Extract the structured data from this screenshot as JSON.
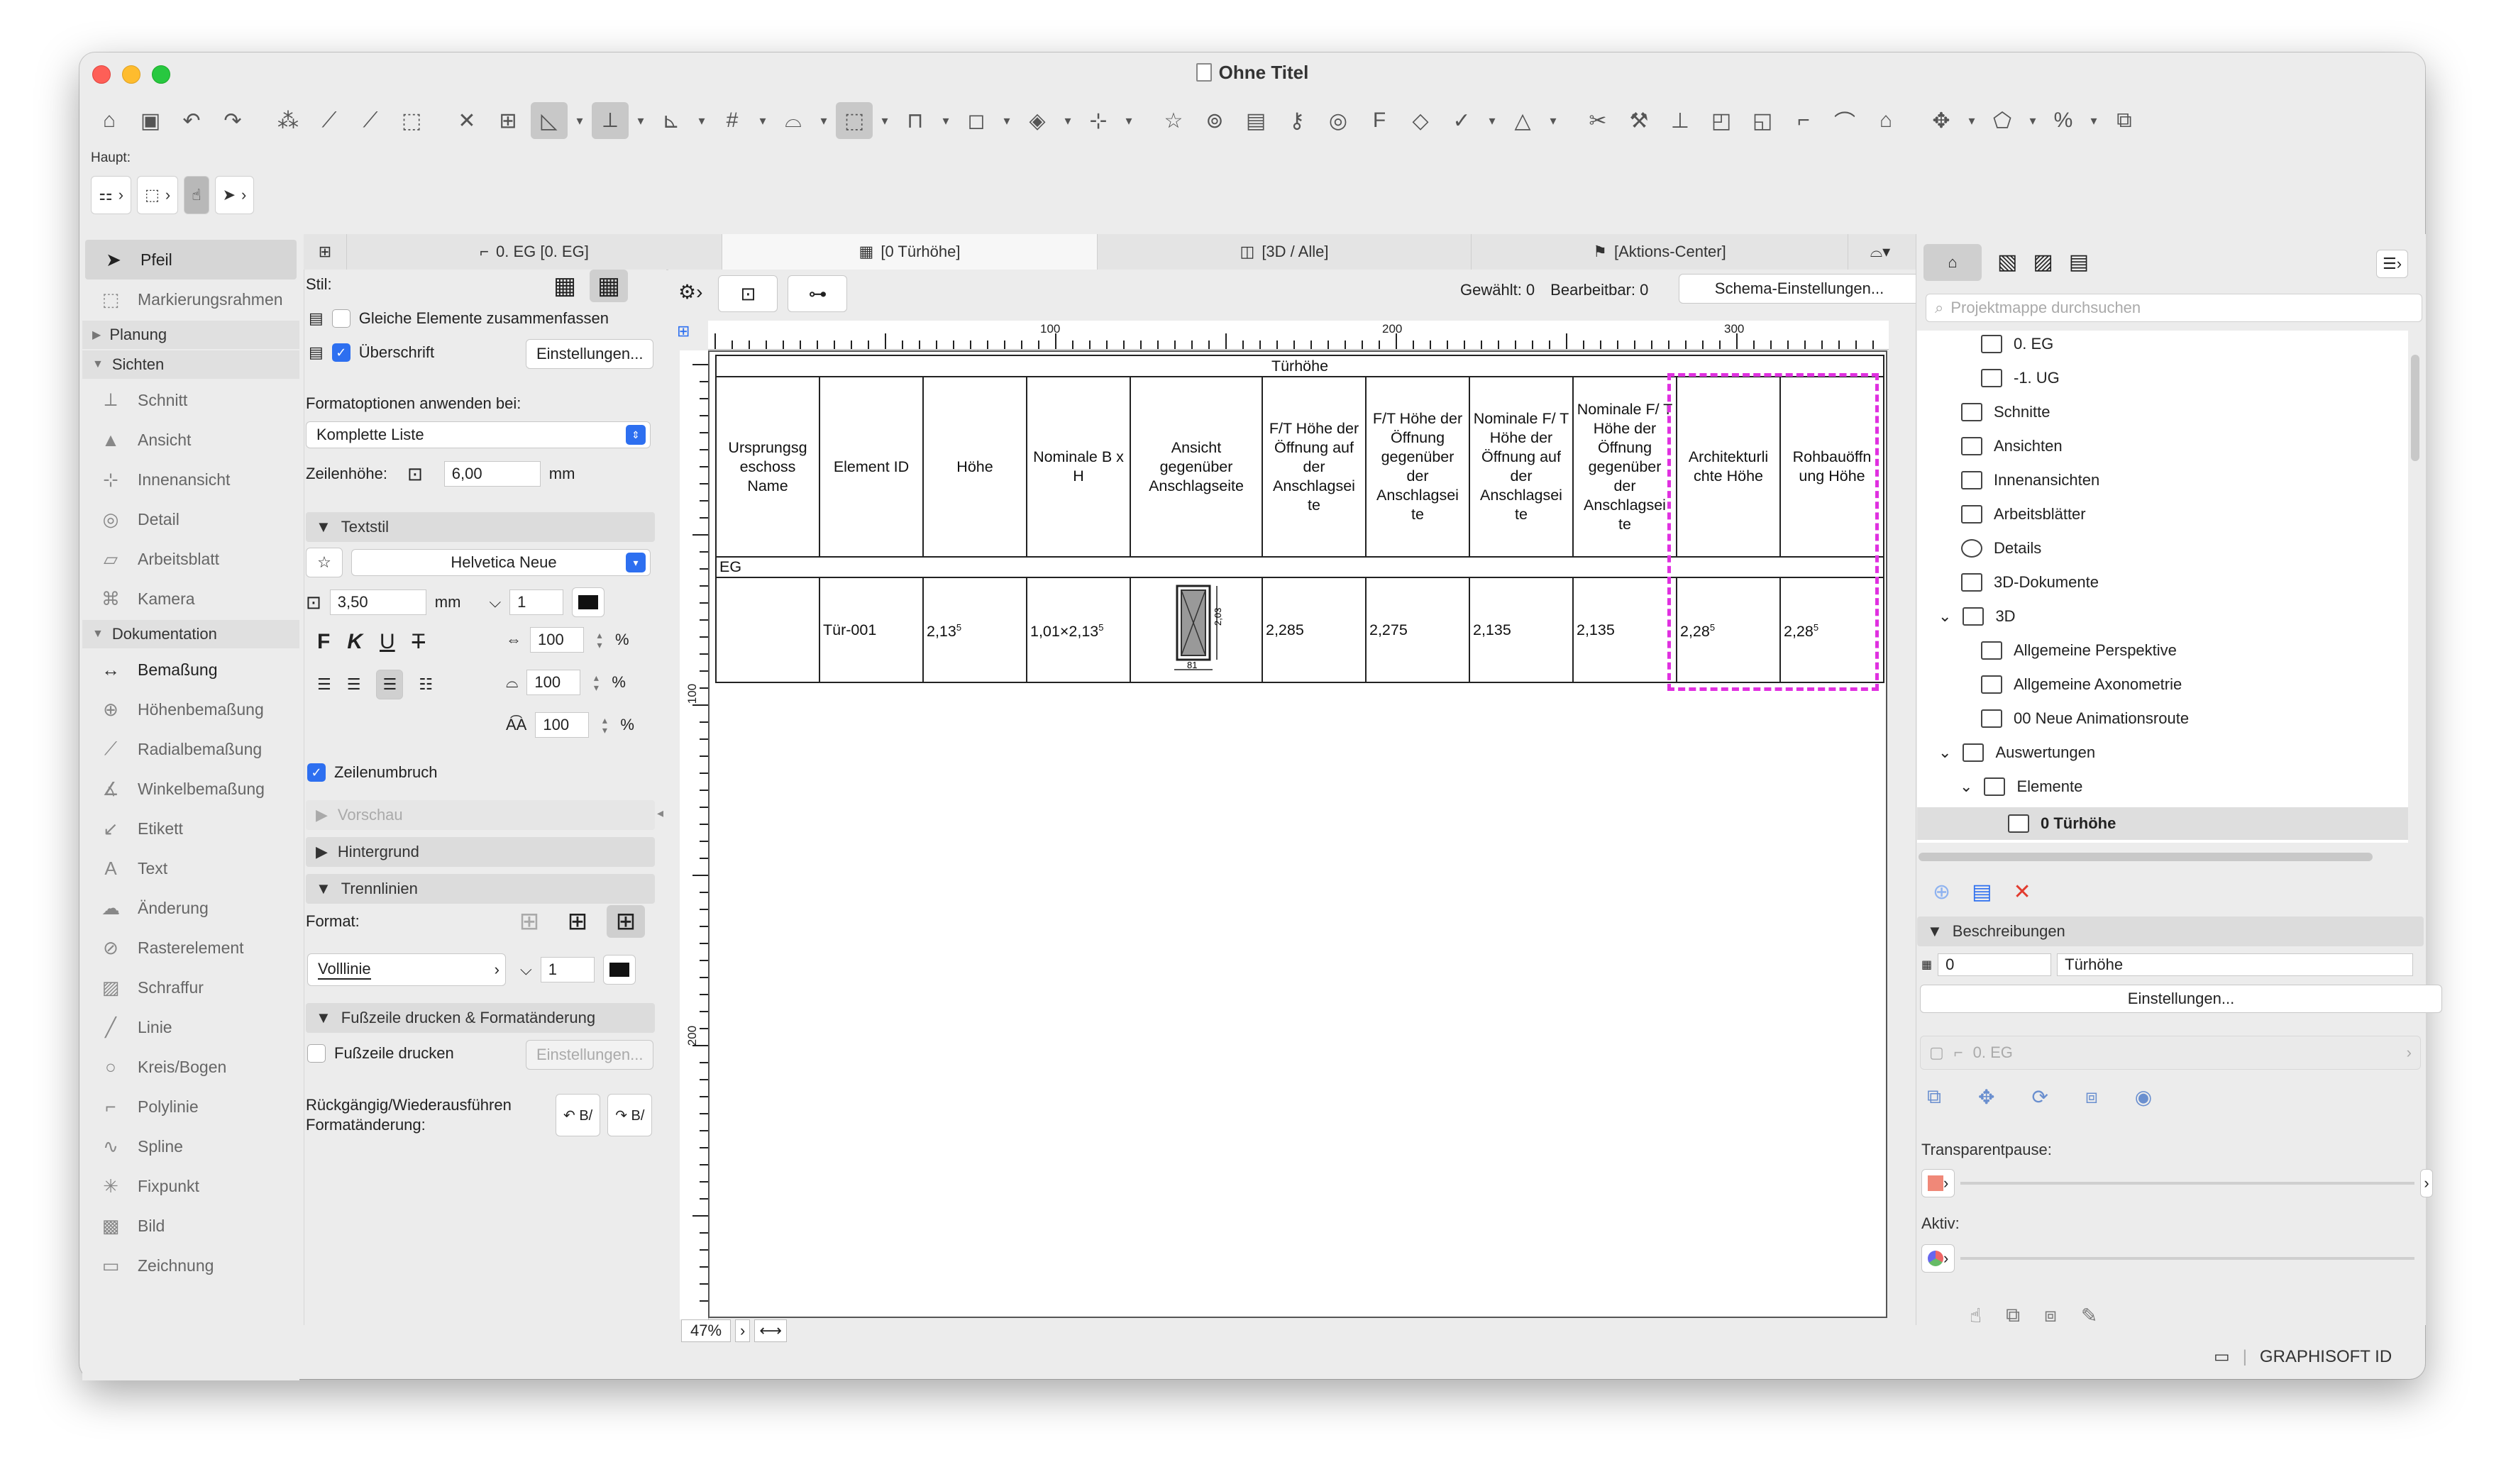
{
  "window": {
    "title": "Ohne Titel"
  },
  "toolbar": {
    "haupt_label": "Haupt:"
  },
  "toolbox": {
    "items": [
      {
        "label": "Pfeil"
      },
      {
        "label": "Markierungsrahmen"
      },
      {
        "label": "Planung"
      },
      {
        "label": "Sichten"
      },
      {
        "label": "Schnitt"
      },
      {
        "label": "Ansicht"
      },
      {
        "label": "Innenansicht"
      },
      {
        "label": "Detail"
      },
      {
        "label": "Arbeitsblatt"
      },
      {
        "label": "Kamera"
      },
      {
        "label": "Dokumentation"
      },
      {
        "label": "Bemaßung"
      },
      {
        "label": "Höhenbemaßung"
      },
      {
        "label": "Radialbemaßung"
      },
      {
        "label": "Winkelbemaßung"
      },
      {
        "label": "Etikett"
      },
      {
        "label": "Text"
      },
      {
        "label": "Änderung"
      },
      {
        "label": "Rasterelement"
      },
      {
        "label": "Schraffur"
      },
      {
        "label": "Linie"
      },
      {
        "label": "Kreis/Bogen"
      },
      {
        "label": "Polylinie"
      },
      {
        "label": "Spline"
      },
      {
        "label": "Fixpunkt"
      },
      {
        "label": "Bild"
      },
      {
        "label": "Zeichnung"
      }
    ]
  },
  "tabs": [
    {
      "label": "0. EG [0. EG]"
    },
    {
      "label": "[0 Türhöhe]"
    },
    {
      "label": "[3D / Alle]"
    },
    {
      "label": "[Aktions-Center]"
    }
  ],
  "panel": {
    "stil_label": "Stil:",
    "gleiche_label": "Gleiche Elemente zusammenfassen",
    "ueberschrift_label": "Überschrift",
    "einstellungen": "Einstellungen...",
    "formatoptionen_label": "Formatoptionen anwenden bei:",
    "formatoptionen_value": "Komplette Liste",
    "zeilenhoehe_label": "Zeilenhöhe:",
    "zeilenhoehe_value": "6,00",
    "unit_mm": "mm",
    "textstil": "Textstil",
    "font": "Helvetica Neue",
    "font_size": "3,50",
    "pen": "1",
    "scale1": "100",
    "scale2": "100",
    "scale3": "100",
    "percent": "%",
    "bold": "F",
    "italic": "K",
    "underline": "U",
    "strike": "T",
    "zeilenumbruch": "Zeilenumbruch",
    "vorschau": "Vorschau",
    "hintergrund": "Hintergrund",
    "trennlinien": "Trennlinien",
    "format_label": "Format:",
    "linetype": "Volllinie",
    "line_pen": "1",
    "fusszeile_section": "Fußzeile drucken & Formatänderung",
    "fusszeile_label": "Fußzeile drucken",
    "fusszeile_btn": "Einstellungen...",
    "undo_label": "Rückgängig/Wiederausführen Formatänderung:"
  },
  "center": {
    "gewaehlt": "Gewählt: 0",
    "bearbeitbar": "Bearbeitbar: 0",
    "schema_btn": "Schema-Einstellungen...",
    "zoom": "47%",
    "ruler_labels": [
      "100",
      "200",
      "300"
    ],
    "ruler_v_labels": [
      "100",
      "200"
    ]
  },
  "schedule": {
    "title": "Türhöhe",
    "headers": [
      "Ursprungsg eschoss Name",
      "Element ID",
      "Höhe",
      "Nominale B x H",
      "Ansicht gegenüber Anschlagseite",
      "F/T Höhe der Öffnung auf der Anschlagsei te",
      "F/T Höhe der Öffnung gegenüber der Anschlagsei te",
      "Nominale F/ T Höhe der Öffnung auf der Anschlagsei te",
      "Nominale F/ T Höhe der Öffnung gegenüber der Anschlagsei te",
      "Architekturli chte Höhe",
      "Rohbauöffn ung Höhe"
    ],
    "group_label": "EG",
    "row": {
      "c1": "",
      "c2": "Tür-001",
      "c3": "2,13",
      "c3_sup": "5",
      "c4": "1,01×2,13",
      "c4_sup": "5",
      "door_dim_h": "2,03",
      "door_dim_w": "81",
      "c6": "2,285",
      "c7": "2,275",
      "c8": "2,135",
      "c9": "2,135",
      "c10": "2,28",
      "c10_sup": "5",
      "c11": "2,28",
      "c11_sup": "5"
    }
  },
  "navigator": {
    "search_placeholder": "Projektmappe durchsuchen",
    "items": [
      {
        "label": "0. EG"
      },
      {
        "label": "-1. UG"
      },
      {
        "label": "Schnitte"
      },
      {
        "label": "Ansichten"
      },
      {
        "label": "Innenansichten"
      },
      {
        "label": "Arbeitsblätter"
      },
      {
        "label": "Details"
      },
      {
        "label": "3D-Dokumente"
      },
      {
        "label": "3D"
      },
      {
        "label": "Allgemeine Perspektive"
      },
      {
        "label": "Allgemeine Axonometrie"
      },
      {
        "label": "00 Neue Animationsroute"
      },
      {
        "label": "Auswertungen"
      },
      {
        "label": "Elemente"
      },
      {
        "label": "0 Türhöhe"
      }
    ],
    "beschreibungen": "Beschreibungen",
    "id_value": "0",
    "name_value": "Türhöhe",
    "einstellungen": "Einstellungen...",
    "layer_value": "0. EG",
    "transparentpause": "Transparentpause:",
    "aktiv": "Aktiv:",
    "brand": "GRAPHISOFT ID"
  },
  "colors": {
    "accent": "#2d6ff0",
    "highlight": "#e030e0",
    "close": "#e23b2e"
  }
}
